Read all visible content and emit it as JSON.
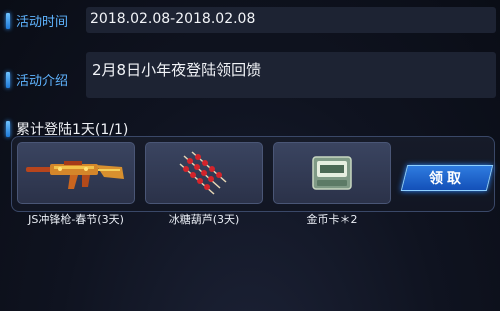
{
  "event_time": {
    "label": "活动时间",
    "value": "2018.02.08-2018.02.08"
  },
  "event_intro": {
    "label": "活动介绍",
    "value": "2月8日小年夜登陆领回馈"
  },
  "accumulate": {
    "label": "累计登陆1天(1/1)"
  },
  "rewards": [
    {
      "name": "JS冲锋枪-春节(3天)",
      "icon": "gold-submachine-gun-icon"
    },
    {
      "name": "冰糖葫芦(3天)",
      "icon": "candied-haws-icon"
    },
    {
      "name": "金币卡＊2",
      "icon": "gold-coin-card-icon"
    }
  ],
  "claim_button": {
    "label": "领取"
  },
  "colors": {
    "label_blue": "#5fb4ff",
    "button_blue": "#1f6fd8",
    "panel_border": "#3a4868"
  }
}
